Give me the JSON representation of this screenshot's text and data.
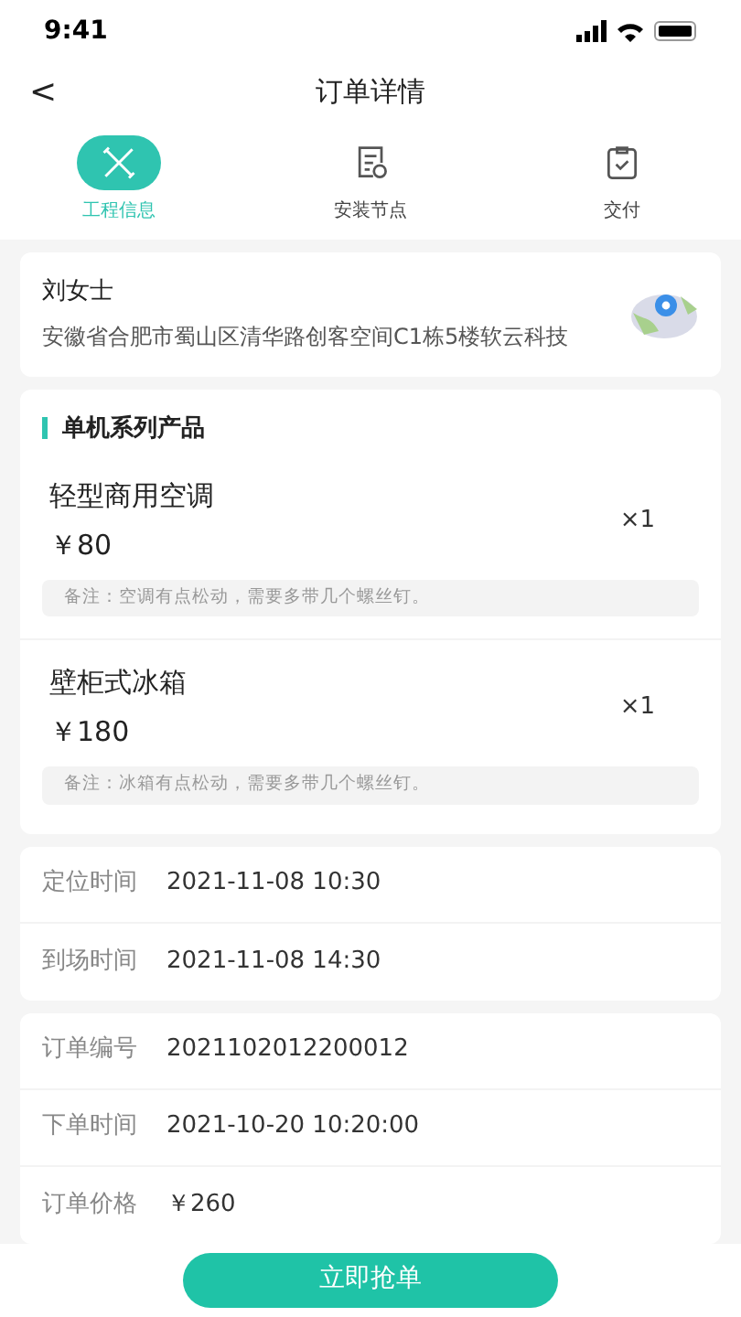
{
  "status_bar": {
    "time": "9:41"
  },
  "header": {
    "back": "<",
    "title": "订单详情"
  },
  "tabs": [
    {
      "label": "工程信息",
      "selected": true,
      "kind": "tools"
    },
    {
      "label": "安装节点",
      "selected": false,
      "kind": "list"
    },
    {
      "label": "交付",
      "selected": false,
      "kind": "check"
    }
  ],
  "customer": {
    "name": "刘女士",
    "address": "安徽省合肥市蜀山区清华路创客空间C1栋5楼软云科技"
  },
  "products": {
    "title": "单机系列产品",
    "items": [
      {
        "name": "轻型商用空调",
        "price": "￥80",
        "quantity": "×1",
        "note": "备注：空调有点松动，需要多带几个螺丝钉。"
      },
      {
        "name": "壁柜式冰箱",
        "price": "￥180",
        "quantity": "×1",
        "note": "备注：冰箱有点松动，需要多带几个螺丝钉。"
      }
    ]
  },
  "times": [
    {
      "label": "定位时间",
      "value": "2021-11-08 10:30"
    },
    {
      "label": "到场时间",
      "value": "2021-11-08 14:30"
    }
  ],
  "order": [
    {
      "label": "订单编号",
      "value": "2021102012200012"
    },
    {
      "label": "下单时间",
      "value": "2021-10-20 10:20:00"
    },
    {
      "label": "订单价格",
      "value": "￥260"
    }
  ],
  "action_button": "立即抢单"
}
